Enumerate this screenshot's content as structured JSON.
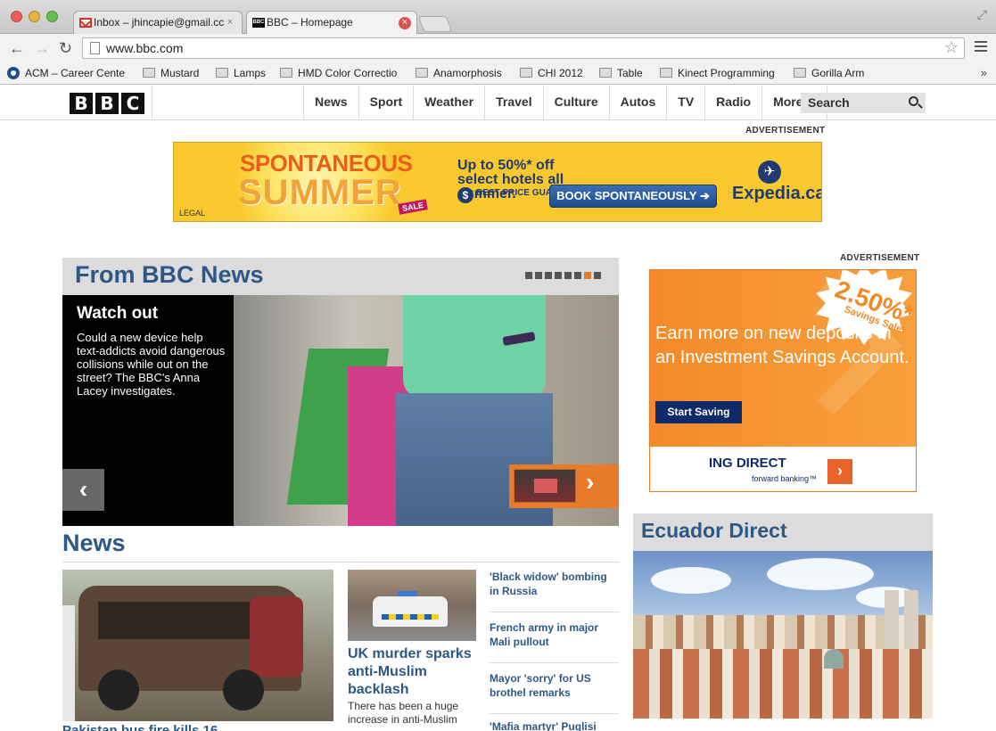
{
  "browser": {
    "tabs": [
      {
        "title": "Inbox – jhincapie@gmail.cc",
        "icon": "gmail-icon",
        "active": false
      },
      {
        "title": "BBC – Homepage",
        "icon": "bbc-favicon",
        "active": true
      }
    ],
    "url": "www.bbc.com",
    "bookmarks": [
      {
        "label": "ACM – Career Cente",
        "icon": "acm-icon"
      },
      {
        "label": "Mustard",
        "icon": "folder-icon"
      },
      {
        "label": "Lamps",
        "icon": "folder-icon"
      },
      {
        "label": "HMD Color Correctio",
        "icon": "folder-icon"
      },
      {
        "label": "Anamorphosis",
        "icon": "folder-icon"
      },
      {
        "label": "CHI 2012",
        "icon": "folder-icon"
      },
      {
        "label": "Table",
        "icon": "folder-icon"
      },
      {
        "label": "Kinect Programming",
        "icon": "folder-icon"
      },
      {
        "label": "Gorilla Arm",
        "icon": "folder-icon"
      }
    ],
    "bookmarks_more": "»"
  },
  "site": {
    "logo": [
      "B",
      "B",
      "C"
    ],
    "nav": [
      "News",
      "Sport",
      "Weather",
      "Travel",
      "Culture",
      "Autos",
      "TV",
      "Radio",
      "More…"
    ],
    "search_label": "Search"
  },
  "ads": {
    "label_top": "ADVERTISEMENT",
    "label_side": "ADVERTISEMENT",
    "expedia": {
      "title_line1": "SPONTANEOUS",
      "title_line2": "SUMMER",
      "sale_tag": "SALE",
      "legal": "LEGAL",
      "headline": "Up to 50%* off select hotels all summer.",
      "guarantee": "BEST PRICE GUARANTEE",
      "button": "BOOK SPONTANEOUSLY ➔",
      "brand": "Expedia.ca",
      "brand_color": "#1e3c72",
      "background": "#f9c82e"
    },
    "ing": {
      "rate": "2.50%*",
      "burst_text": "Savings Sale!",
      "copy": "Earn more on new deposits in an Investment Savings Account.",
      "button": "Start Saving",
      "brand": "ING DIRECT",
      "tagline": "forward banking™",
      "accent": "#f48a2a"
    }
  },
  "carousel": {
    "heading": "From BBC News",
    "dot_count": 8,
    "active_dot_index": 7,
    "story_title": "Watch out",
    "story_text": "Could a new device help text-addicts avoid dangerous collisions while out on the street? The BBC's Anna Lacey investigates.",
    "prev": "‹",
    "next": "›"
  },
  "news": {
    "heading": "News",
    "lead_title": "Pakistan bus fire kills 16",
    "story2": {
      "title": "UK murder sparks anti-Muslim backlash",
      "desc": "There has been a huge increase in anti-Muslim"
    },
    "headlines": [
      "'Black widow' bombing in Russia",
      "French army in major Mali pullout",
      "Mayor 'sorry' for US brothel remarks",
      "'Mafia martyr' Puglisi"
    ]
  },
  "ecuador": {
    "heading": "Ecuador Direct"
  },
  "colors": {
    "heading_blue": "#2d5886",
    "accent_orange": "#e87b2a"
  }
}
